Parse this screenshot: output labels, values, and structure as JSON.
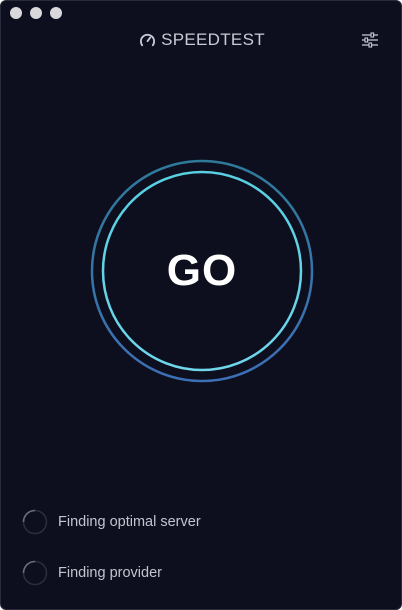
{
  "window": {
    "traffic_lights": [
      "close-dot",
      "minimize-dot",
      "zoom-dot"
    ]
  },
  "header": {
    "brand_icon": "speedometer-icon",
    "brand_name": "SPEEDTEST",
    "settings_icon": "sliders-icon"
  },
  "main": {
    "go_label": "GO"
  },
  "status": [
    {
      "label": "Finding optimal server",
      "icon": "spinner-icon"
    },
    {
      "label": "Finding provider",
      "icon": "spinner-icon"
    }
  ],
  "colors": {
    "background": "#0e0f1e",
    "ring_inner": "#5ad3e6",
    "ring_outer": "#3a7fb0",
    "text": "#c3c4d0",
    "go_text": "#ffffff"
  }
}
